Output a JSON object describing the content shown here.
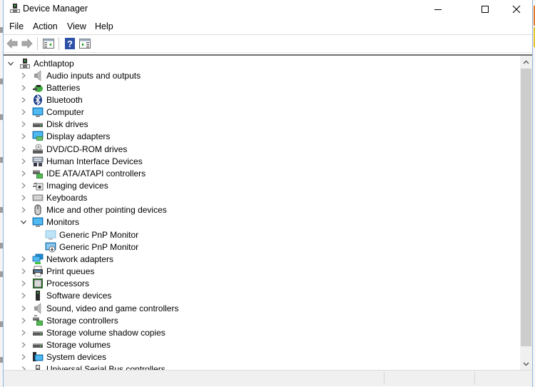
{
  "window": {
    "title": "Device Manager",
    "controls": {
      "minimize": "minimize",
      "maximize": "maximize",
      "close": "close"
    }
  },
  "menubar": {
    "items": [
      {
        "label": "File"
      },
      {
        "label": "Action"
      },
      {
        "label": "View"
      },
      {
        "label": "Help"
      }
    ]
  },
  "toolbar": {
    "buttons": [
      {
        "name": "back",
        "icon": "arrow-left-icon",
        "enabled": false
      },
      {
        "name": "forward",
        "icon": "arrow-right-icon",
        "enabled": false
      },
      {
        "name": "show-hide-console-tree",
        "icon": "console-tree-icon",
        "enabled": true
      },
      {
        "name": "help",
        "icon": "help-icon",
        "enabled": true
      },
      {
        "name": "show-hide-action-pane",
        "icon": "action-pane-icon",
        "enabled": true
      }
    ]
  },
  "tree": {
    "root": {
      "label": "Achtlaptop",
      "expanded": true,
      "icon": "computer-network-icon"
    },
    "categories": [
      {
        "label": "Audio inputs and outputs",
        "icon": "speaker-icon",
        "expanded": false
      },
      {
        "label": "Batteries",
        "icon": "battery-icon",
        "expanded": false
      },
      {
        "label": "Bluetooth",
        "icon": "bluetooth-icon",
        "expanded": false
      },
      {
        "label": "Computer",
        "icon": "monitor-icon",
        "expanded": false
      },
      {
        "label": "Disk drives",
        "icon": "disk-drive-icon",
        "expanded": false
      },
      {
        "label": "Display adapters",
        "icon": "display-adapter-icon",
        "expanded": false
      },
      {
        "label": "DVD/CD-ROM drives",
        "icon": "dvd-drive-icon",
        "expanded": false
      },
      {
        "label": "Human Interface Devices",
        "icon": "hid-icon",
        "expanded": false
      },
      {
        "label": "IDE ATA/ATAPI controllers",
        "icon": "ide-controller-icon",
        "expanded": false
      },
      {
        "label": "Imaging devices",
        "icon": "camera-icon",
        "expanded": false
      },
      {
        "label": "Keyboards",
        "icon": "keyboard-icon",
        "expanded": false
      },
      {
        "label": "Mice and other pointing devices",
        "icon": "mouse-icon",
        "expanded": false
      },
      {
        "label": "Monitors",
        "icon": "monitor-icon",
        "expanded": true,
        "children": [
          {
            "label": "Generic PnP Monitor",
            "icon": "monitor-light-icon"
          },
          {
            "label": "Generic PnP Monitor",
            "icon": "monitor-download-icon"
          }
        ]
      },
      {
        "label": "Network adapters",
        "icon": "network-adapter-icon",
        "expanded": false
      },
      {
        "label": "Print queues",
        "icon": "printer-icon",
        "expanded": false
      },
      {
        "label": "Processors",
        "icon": "processor-icon",
        "expanded": false
      },
      {
        "label": "Software devices",
        "icon": "software-device-icon",
        "expanded": false
      },
      {
        "label": "Sound, video and game controllers",
        "icon": "speaker-icon",
        "expanded": false
      },
      {
        "label": "Storage controllers",
        "icon": "storage-controller-icon",
        "expanded": false
      },
      {
        "label": "Storage volume shadow copies",
        "icon": "disk-drive-icon",
        "expanded": false
      },
      {
        "label": "Storage volumes",
        "icon": "disk-drive-icon",
        "expanded": false
      },
      {
        "label": "System devices",
        "icon": "system-device-icon",
        "expanded": false
      },
      {
        "label": "Universal Serial Bus controllers",
        "icon": "usb-icon",
        "expanded": false
      }
    ]
  },
  "scrollbar": {
    "position_fraction": 0.0,
    "visible_fraction": 0.95
  },
  "statusbar": {
    "panes": [
      "",
      "",
      ""
    ]
  }
}
